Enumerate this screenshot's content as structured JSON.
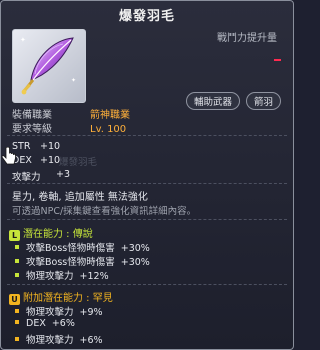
{
  "item": {
    "name": "爆發羽毛",
    "power_label": "戰鬥力提升量",
    "tags": [
      "輔助武器",
      "箭羽"
    ]
  },
  "requirements": [
    {
      "label": "裝備職業",
      "value": "箭神職業"
    },
    {
      "label": "要求等級",
      "value": "Lv. 100"
    }
  ],
  "stats": [
    {
      "label": "STR",
      "value": "+10"
    },
    {
      "label": "DEX",
      "value": "+10"
    },
    {
      "label": "攻擊力",
      "value": "+3"
    }
  ],
  "ghost_text": "爆發羽毛",
  "notes": {
    "line1": "星力, 卷軸, 追加屬性 無法強化",
    "line2": "可透過NPC/採集鍵查看強化資訊詳細內容。"
  },
  "potential": {
    "icon": "L",
    "title": "潛在能力 : 傳說",
    "color": "#c6e43a",
    "lines": [
      {
        "label": "攻擊Boss怪物時傷害",
        "value": "+30%"
      },
      {
        "label": "攻擊Boss怪物時傷害",
        "value": "+30%"
      },
      {
        "label": "物理攻擊力",
        "value": "+12%"
      }
    ]
  },
  "additional_potential": {
    "icon": "U",
    "title": "附加潛在能力 : 罕見",
    "color": "#f2b420",
    "lines": [
      {
        "label": "物理攻擊力",
        "value": "+9%"
      },
      {
        "label": "DEX",
        "value": "+6%"
      },
      {
        "label": "物理攻擊力",
        "value": "+6%"
      }
    ]
  }
}
